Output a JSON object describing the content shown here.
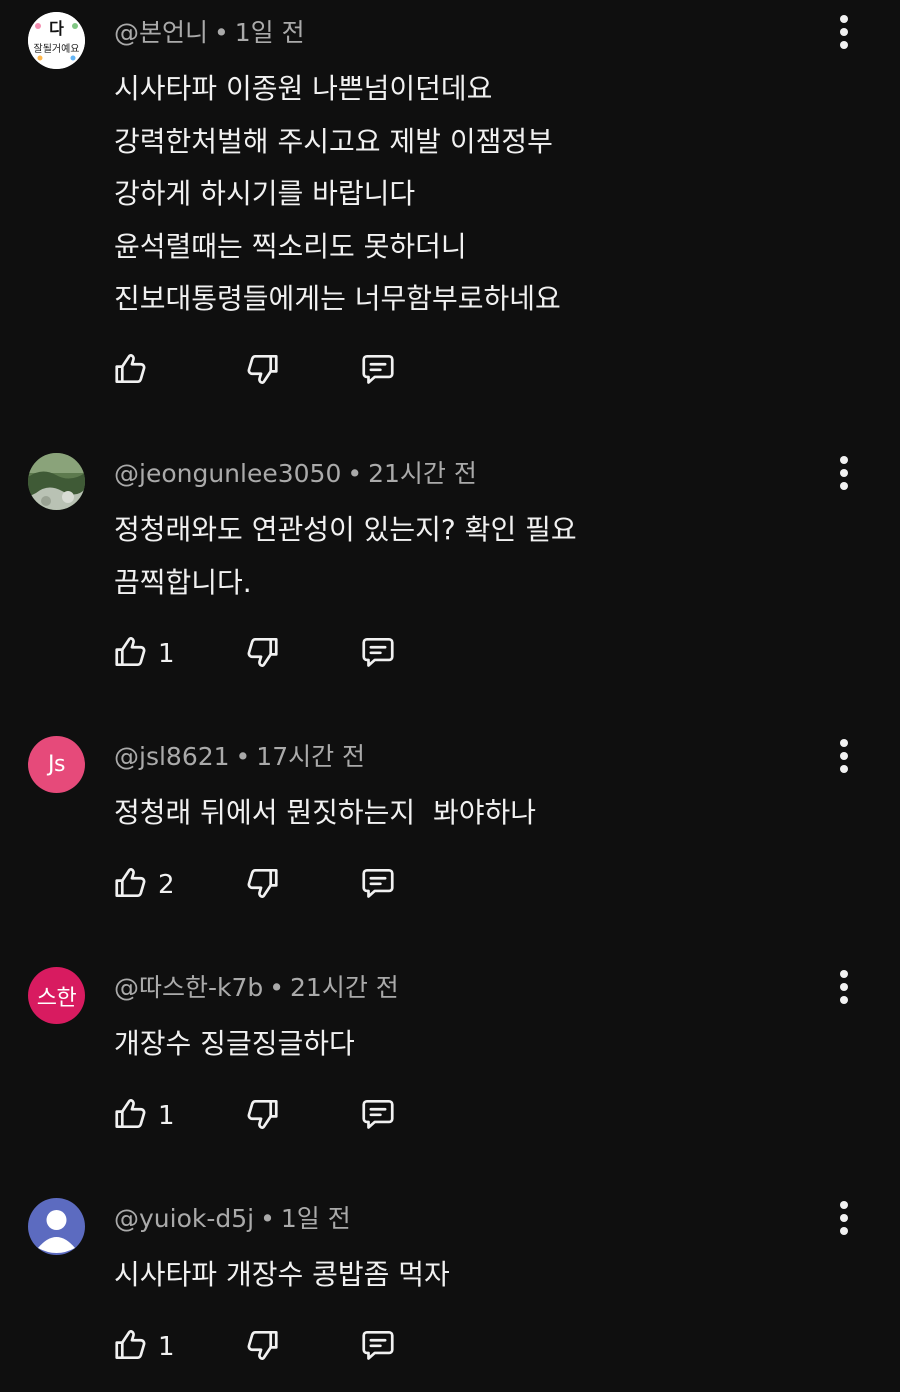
{
  "comments": [
    {
      "author": "@본언니",
      "time": "1일 전",
      "avatar": {
        "type": "image",
        "label": "다잘될거예요"
      },
      "lines": [
        "시사타파 이종원 나쁜넘이던데요",
        "강력한처벌해 주시고요 제발 이잼정부",
        "강하게 하시기를 바랍니다",
        "윤석렬때는 찍소리도 못하더니",
        "진보대통령들에게는 너무함부로하네요"
      ],
      "likes": ""
    },
    {
      "author": "@jeongunlee3050",
      "time": "21시간 전",
      "avatar": {
        "type": "photo",
        "label": ""
      },
      "lines": [
        "정청래와도 연관성이 있는지? 확인 필요",
        "끔찍합니다."
      ],
      "likes": "1"
    },
    {
      "author": "@jsl8621",
      "time": "17시간 전",
      "avatar": {
        "type": "initials",
        "label": "Js",
        "color": "#e64a7a"
      },
      "lines": [
        "정청래 뒤에서 뭔짓하는지  봐야하나"
      ],
      "likes": "2"
    },
    {
      "author": "@따스한-k7b",
      "time": "21시간 전",
      "avatar": {
        "type": "initials",
        "label": "스한",
        "color": "#d81b60"
      },
      "lines": [
        "개장수 징글징글하다"
      ],
      "likes": "1"
    },
    {
      "author": "@yuiok-d5j",
      "time": "1일 전",
      "avatar": {
        "type": "default",
        "label": "",
        "color": "#5c6bc0"
      },
      "lines": [
        "시사타파 개장수 콩밥좀 먹자"
      ],
      "likes": "1"
    }
  ],
  "icons": {
    "like": "thumbs-up-icon",
    "dislike": "thumbs-down-icon",
    "reply": "reply-icon",
    "menu": "more-vert-icon"
  }
}
